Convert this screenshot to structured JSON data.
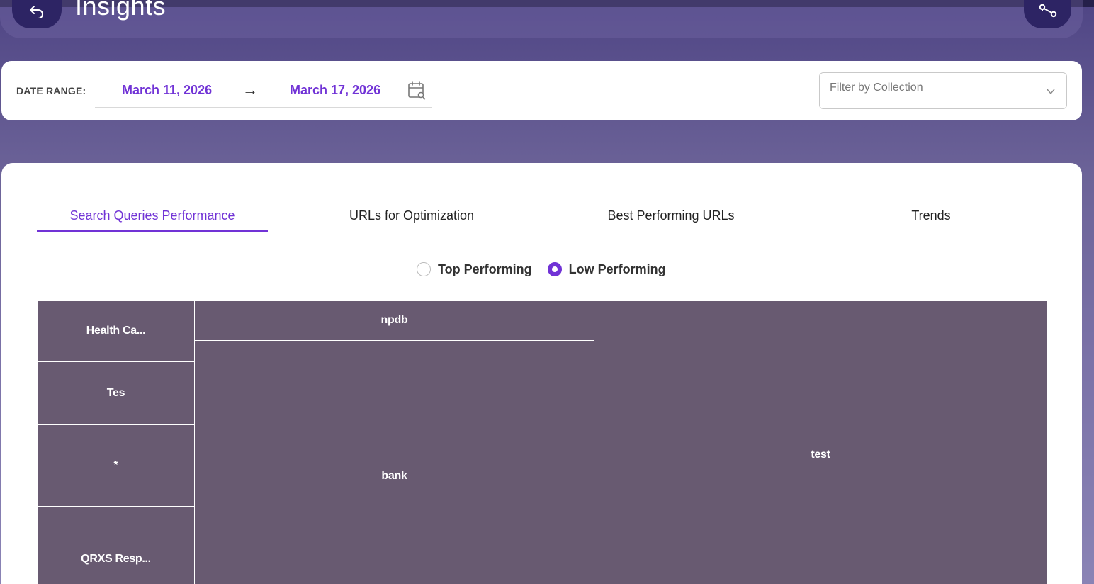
{
  "header": {
    "title": "Insights",
    "back_icon": "undo-arrow-icon",
    "share_icon": "share-icon"
  },
  "date_range": {
    "label": "DATE RANGE:",
    "start": "March 11, 2026",
    "arrow": "→",
    "end": "March 17, 2026",
    "calendar_icon": "calendar-search-icon"
  },
  "filter": {
    "placeholder": "Filter by Collection"
  },
  "tabs": [
    {
      "label": "Search Queries Performance",
      "active": true
    },
    {
      "label": "URLs for Optimization",
      "active": false
    },
    {
      "label": "Best Performing URLs",
      "active": false
    },
    {
      "label": "Trends",
      "active": false
    }
  ],
  "performance_toggle": {
    "options": [
      {
        "label": "Top Performing",
        "checked": false
      },
      {
        "label": "Low Performing",
        "checked": true
      }
    ]
  },
  "treemap": {
    "color": "#685a71",
    "cells": [
      {
        "label": "Health Ca..."
      },
      {
        "label": "Tes"
      },
      {
        "label": "*"
      },
      {
        "label": "QRXS Resp..."
      },
      {
        "label": "npdb"
      },
      {
        "label": "bank"
      },
      {
        "label": "test"
      }
    ]
  },
  "colors": {
    "accent": "#7133d6",
    "header_button": "#2d2464"
  }
}
